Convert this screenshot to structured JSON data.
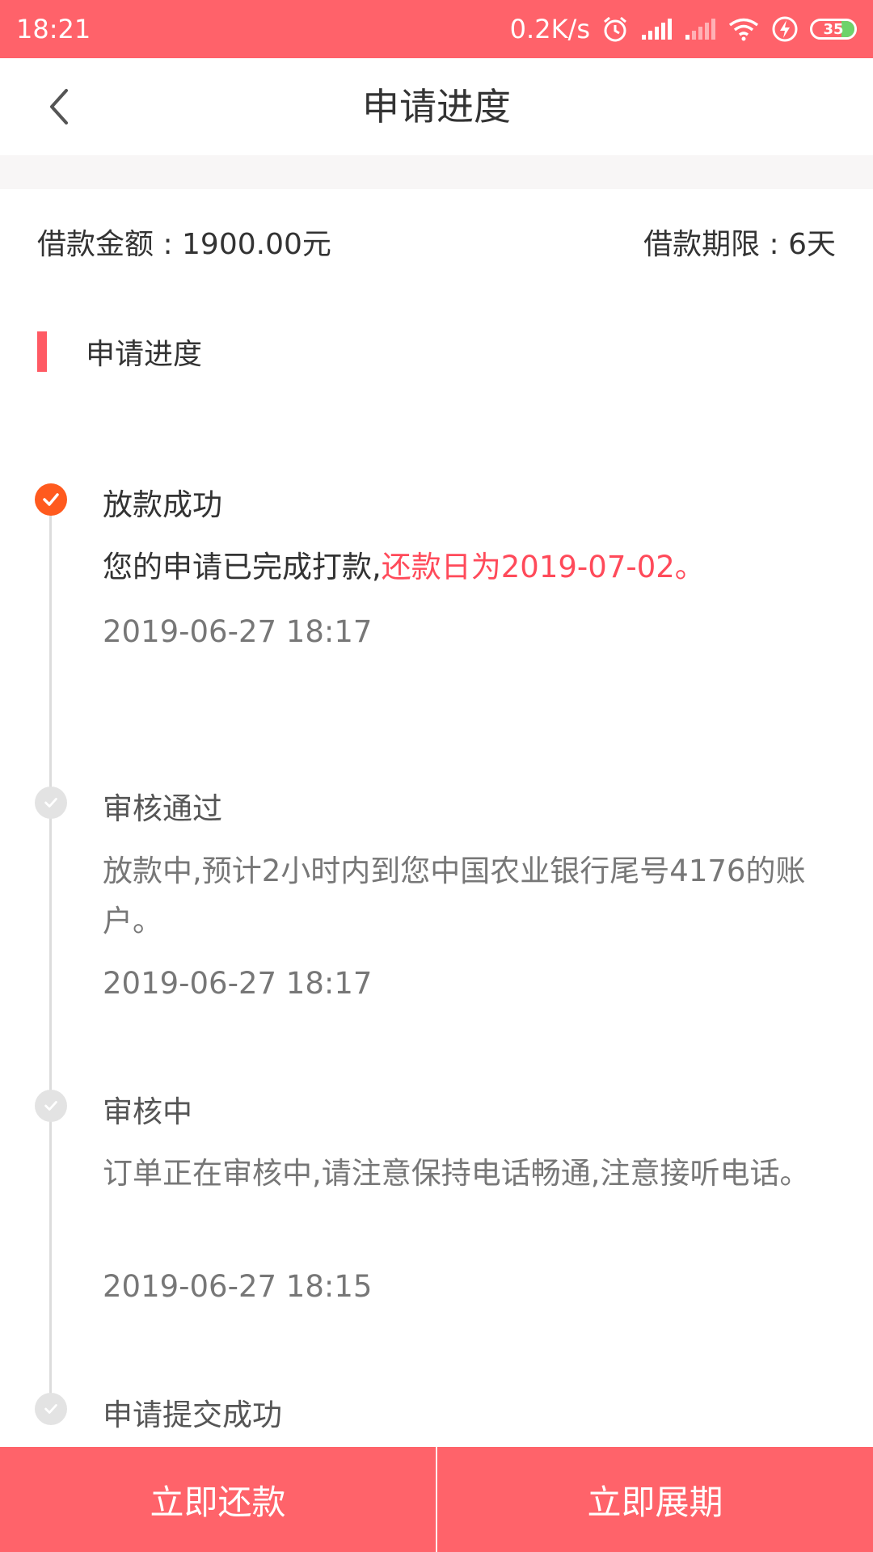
{
  "status_bar": {
    "time": "18:21",
    "network_speed": "0.2K/s",
    "battery": "35",
    "icons": [
      "alarm-icon",
      "signal-icon",
      "signal-weak-icon",
      "wifi-icon",
      "charging-icon",
      "battery-icon"
    ]
  },
  "nav": {
    "title": "申请进度",
    "back_icon": "chevron-left-icon"
  },
  "loan": {
    "amount_label": "借款金额 : 1900.00元",
    "term_label": "借款期限 : 6天"
  },
  "section": {
    "title": "申请进度"
  },
  "steps": [
    {
      "title": "放款成功",
      "desc_prefix": "您的申请已完成打款,",
      "desc_highlight": "还款日为2019-07-02。",
      "time": "2019-06-27 18:17",
      "status": "done"
    },
    {
      "title": "审核通过",
      "desc": "放款中,预计2小时内到您中国农业银行尾号4176的账户。",
      "time": "2019-06-27 18:17",
      "status": "past"
    },
    {
      "title": "审核中",
      "desc": "订单正在审核中,请注意保持电话畅通,注意接听电话。",
      "time": "2019-06-27 18:15",
      "status": "past"
    },
    {
      "title": "申请提交成功",
      "status": "past"
    }
  ],
  "actions": {
    "repay_label": "立即还款",
    "extend_label": "立即展期"
  },
  "colors": {
    "brand": "#ff626a",
    "active_dot": "#ff5a1e",
    "highlight_text": "#ff4a5a",
    "inactive_dot": "#e3e3e3"
  }
}
